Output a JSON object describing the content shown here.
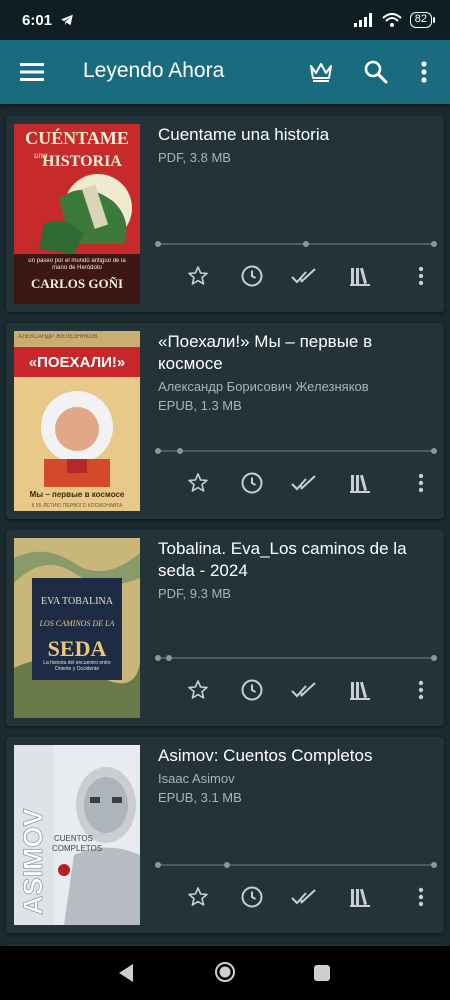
{
  "status": {
    "time": "6:01",
    "battery": "82"
  },
  "appbar": {
    "title": "Leyendo Ahora"
  },
  "books": [
    {
      "title": "Cuentame una historia",
      "author": "",
      "meta": "PDF, 3.8 MB",
      "progress_points": [
        0,
        0.55,
        1
      ],
      "cover": {
        "text1": "CUÉNTAME",
        "text2": "una",
        "text3": "HISTORIA",
        "text4": "un paseo por el mundo antiguo de la mano de Heródoto",
        "text5": "CARLOS GOÑI"
      }
    },
    {
      "title": "«Поехали!» Мы – первые в космосе",
      "author": "Александр Борисович Железняков",
      "meta": "EPUB, 1.3 MB",
      "progress_points": [
        0,
        0.08,
        1
      ],
      "cover": {
        "text1": "АЛЕКСАНДР ЖЕЛЕЗНЯКОВ",
        "text2": "«ПОЕХАЛИ!»",
        "text3": "Мы – первые в космосе",
        "text4": "К 55-ЛЕТИЮ ПЕРВОГО КОСМОНАВТА"
      }
    },
    {
      "title": "Tobalina. Eva_Los caminos de la seda - 2024",
      "author": "",
      "meta": "PDF, 9.3 MB",
      "progress_points": [
        0,
        0.04,
        1
      ],
      "cover": {
        "text1": "EVA TOBALINA",
        "text2": "LOS CAMINOS DE LA",
        "text3": "SEDA",
        "text4": "La historia del encuentro entre Oriente y Occidente"
      }
    },
    {
      "title": "Asimov: Cuentos Completos",
      "author": "Isaac Asimov",
      "meta": "EPUB, 3.1 MB",
      "progress_points": [
        0,
        0.25,
        1
      ],
      "cover": {
        "text1": "ASIMOV",
        "text2": "CUENTOS",
        "text3": "COMPLETOS"
      }
    }
  ],
  "colors": {
    "appbar": "#1b6b80",
    "card": "#233339",
    "background": "#1a2a2f"
  }
}
